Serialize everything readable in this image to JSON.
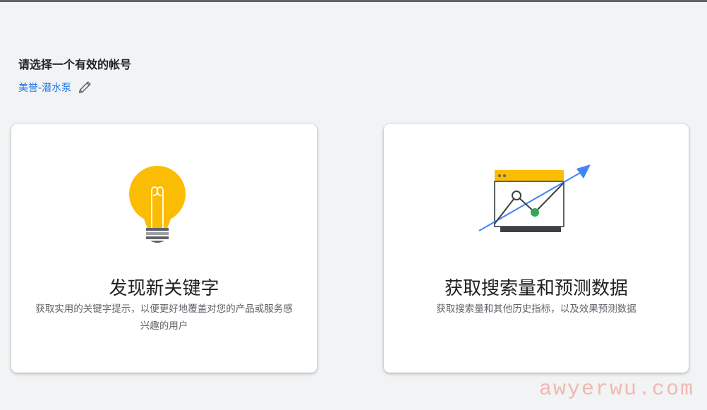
{
  "header": {
    "title": "请选择一个有效的帐号",
    "account_name": "美誉-潜水泵"
  },
  "cards": [
    {
      "title": "发现新关键字",
      "description": "获取实用的关键字提示，以便更好地覆盖对您的产品或服务感兴趣的用户",
      "icon": "lightbulb-icon"
    },
    {
      "title": "获取搜索量和预测数据",
      "description": "获取搜索量和其他历史指标，以及效果预测数据",
      "icon": "trend-chart-icon"
    }
  ],
  "watermark": "awyerwu.com",
  "colors": {
    "background": "#f1f3f4",
    "link": "#1a73e8",
    "bulb": "#fbbc04",
    "arrow": "#4285f4",
    "point": "#34a853"
  }
}
